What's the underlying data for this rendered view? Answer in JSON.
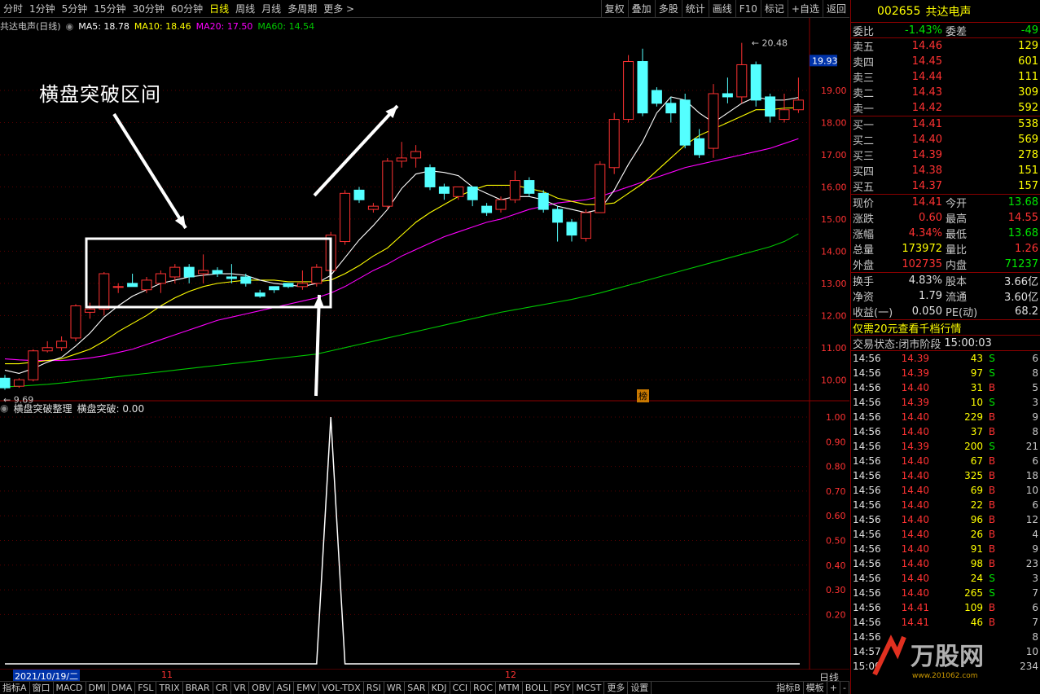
{
  "toolbar": {
    "items": [
      "分时",
      "1分钟",
      "5分钟",
      "15分钟",
      "30分钟",
      "60分钟",
      "日线",
      "周线",
      "月线",
      "多周期",
      "更多 >"
    ],
    "active": "日线",
    "right_items": [
      "复权",
      "叠加",
      "多股",
      "统计",
      "画线",
      "F10",
      "标记",
      "+自选",
      "返回"
    ]
  },
  "stock": {
    "code": "002655",
    "name": "共达电声"
  },
  "legend": {
    "title": "共达电声(日线)",
    "ma5": "MA5: 18.78",
    "ma10": "MA10: 18.46",
    "ma20": "MA20: 17.50",
    "ma60": "MA60: 14.54"
  },
  "colors": {
    "ma5": "#ffffff",
    "ma10": "#ffff00",
    "ma20": "#ff00ff",
    "ma60": "#00c800",
    "up": "#ff3232",
    "down": "#54ffff",
    "axis": "#8b0000"
  },
  "chart_data": [
    {
      "type": "candlestick",
      "title": "共达电声(日线)",
      "ylim": [
        9.5,
        20.8
      ],
      "yticks": [
        10.0,
        11.0,
        12.0,
        13.0,
        14.0,
        15.0,
        16.0,
        17.0,
        18.0,
        19.0
      ],
      "current_price_label": "19.93",
      "high_label": "20.48",
      "low_label": "9.69",
      "candles": [
        [
          10.05,
          9.75,
          10.15,
          9.69
        ],
        [
          9.8,
          10.0,
          10.05,
          9.75
        ],
        [
          10.0,
          10.9,
          10.95,
          9.95
        ],
        [
          10.9,
          11.0,
          11.2,
          10.85
        ],
        [
          11.0,
          11.2,
          11.35,
          10.9
        ],
        [
          11.3,
          12.3,
          12.35,
          11.2
        ],
        [
          12.1,
          12.2,
          12.4,
          11.9
        ],
        [
          12.2,
          13.3,
          13.35,
          12.0
        ],
        [
          12.9,
          12.9,
          13.0,
          12.7
        ],
        [
          13.0,
          12.9,
          13.3,
          12.9
        ],
        [
          12.8,
          13.1,
          13.2,
          12.7
        ],
        [
          13.0,
          13.3,
          13.4,
          12.7
        ],
        [
          13.2,
          13.5,
          13.6,
          13.0
        ],
        [
          13.5,
          13.2,
          13.6,
          13.0
        ],
        [
          13.3,
          13.4,
          13.9,
          13.0
        ],
        [
          13.4,
          13.3,
          13.5,
          13.2
        ],
        [
          13.2,
          13.15,
          13.6,
          13.0
        ],
        [
          13.2,
          13.0,
          13.3,
          12.9
        ],
        [
          12.7,
          12.6,
          12.8,
          12.55
        ],
        [
          12.9,
          12.8,
          12.9,
          12.7
        ],
        [
          13.0,
          12.9,
          13.0,
          12.85
        ],
        [
          12.9,
          13.0,
          13.4,
          12.8
        ],
        [
          13.0,
          13.5,
          13.6,
          12.9
        ],
        [
          13.4,
          14.5,
          14.6,
          13.3
        ],
        [
          14.3,
          15.8,
          15.9,
          14.2
        ],
        [
          15.9,
          15.6,
          16.0,
          15.5
        ],
        [
          15.3,
          15.4,
          15.5,
          15.2
        ],
        [
          15.4,
          16.8,
          16.9,
          15.3
        ],
        [
          16.8,
          16.9,
          17.4,
          16.6
        ],
        [
          16.9,
          17.1,
          17.3,
          16.6
        ],
        [
          16.6,
          16.0,
          16.7,
          15.9
        ],
        [
          16.0,
          15.8,
          16.1,
          15.6
        ],
        [
          15.7,
          16.0,
          16.0,
          15.6
        ],
        [
          16.0,
          15.6,
          16.0,
          15.4
        ],
        [
          15.4,
          15.2,
          15.5,
          15.1
        ],
        [
          15.3,
          15.6,
          15.7,
          15.2
        ],
        [
          15.6,
          16.2,
          16.5,
          15.5
        ],
        [
          16.2,
          15.8,
          16.3,
          15.7
        ],
        [
          15.8,
          15.3,
          15.9,
          15.2
        ],
        [
          15.3,
          14.9,
          15.4,
          14.3
        ],
        [
          14.9,
          14.5,
          15.0,
          14.3
        ],
        [
          14.4,
          15.2,
          15.3,
          14.3
        ],
        [
          15.2,
          16.7,
          16.8,
          15.2
        ],
        [
          16.6,
          18.1,
          18.3,
          16.4
        ],
        [
          18.1,
          19.9,
          20.1,
          18.0
        ],
        [
          19.9,
          18.3,
          20.3,
          18.2
        ],
        [
          19.0,
          18.6,
          19.1,
          18.5
        ],
        [
          18.6,
          18.3,
          18.8,
          18.0
        ],
        [
          18.7,
          17.3,
          18.9,
          17.2
        ],
        [
          17.5,
          17.0,
          17.8,
          16.9
        ],
        [
          17.2,
          18.9,
          19.2,
          16.9
        ],
        [
          18.9,
          18.8,
          19.4,
          18.6
        ],
        [
          18.8,
          19.8,
          20.48,
          18.6
        ],
        [
          19.8,
          18.7,
          19.9,
          18.5
        ],
        [
          18.8,
          18.2,
          18.9,
          18.0
        ],
        [
          18.1,
          18.4,
          18.9,
          18.0
        ],
        [
          18.4,
          18.7,
          19.4,
          18.3
        ]
      ],
      "ma5": [
        10.3,
        10.2,
        10.35,
        10.55,
        10.7,
        11.05,
        11.45,
        11.95,
        12.3,
        12.6,
        12.8,
        13.0,
        13.1,
        13.2,
        13.25,
        13.3,
        13.3,
        13.25,
        13.1,
        13.0,
        12.95,
        12.9,
        13.0,
        13.25,
        13.8,
        14.35,
        14.8,
        15.3,
        15.95,
        16.4,
        16.5,
        16.45,
        16.35,
        16.0,
        15.8,
        15.6,
        15.7,
        15.7,
        15.6,
        15.4,
        15.3,
        15.2,
        15.3,
        15.9,
        16.7,
        17.4,
        18.3,
        18.8,
        18.7,
        18.3,
        18.0,
        18.3,
        18.6,
        18.8,
        18.7,
        18.7,
        18.78
      ],
      "ma10": [
        10.5,
        10.5,
        10.55,
        10.6,
        10.65,
        10.8,
        10.95,
        11.2,
        11.5,
        11.75,
        12.0,
        12.3,
        12.55,
        12.75,
        12.9,
        13.0,
        13.05,
        13.1,
        13.1,
        13.1,
        13.05,
        13.05,
        13.05,
        13.1,
        13.3,
        13.55,
        13.85,
        14.1,
        14.5,
        14.9,
        15.2,
        15.45,
        15.7,
        15.9,
        16.05,
        16.05,
        16.05,
        15.95,
        15.85,
        15.65,
        15.55,
        15.45,
        15.45,
        15.5,
        15.8,
        16.1,
        16.5,
        16.9,
        17.3,
        17.6,
        17.8,
        18.0,
        18.2,
        18.4,
        18.4,
        18.45,
        18.46
      ],
      "ma20": [
        10.65,
        10.62,
        10.6,
        10.6,
        10.6,
        10.63,
        10.68,
        10.75,
        10.85,
        10.95,
        11.1,
        11.25,
        11.4,
        11.55,
        11.7,
        11.85,
        11.95,
        12.05,
        12.15,
        12.25,
        12.35,
        12.45,
        12.55,
        12.7,
        12.9,
        13.15,
        13.4,
        13.6,
        13.85,
        14.05,
        14.25,
        14.45,
        14.6,
        14.75,
        14.9,
        15.0,
        15.15,
        15.3,
        15.4,
        15.5,
        15.55,
        15.6,
        15.7,
        15.85,
        16.0,
        16.15,
        16.3,
        16.45,
        16.6,
        16.7,
        16.8,
        16.9,
        17.0,
        17.1,
        17.2,
        17.35,
        17.5
      ],
      "ma60": [
        9.78,
        9.8,
        9.83,
        9.86,
        9.9,
        9.95,
        10.0,
        10.05,
        10.1,
        10.15,
        10.2,
        10.25,
        10.3,
        10.35,
        10.4,
        10.45,
        10.5,
        10.55,
        10.6,
        10.65,
        10.7,
        10.75,
        10.8,
        10.9,
        11.0,
        11.1,
        11.2,
        11.3,
        11.4,
        11.5,
        11.6,
        11.7,
        11.8,
        11.9,
        12.0,
        12.1,
        12.18,
        12.26,
        12.34,
        12.42,
        12.5,
        12.6,
        12.7,
        12.82,
        12.94,
        13.06,
        13.18,
        13.3,
        13.42,
        13.54,
        13.66,
        13.78,
        13.9,
        14.02,
        14.14,
        14.3,
        14.54
      ]
    },
    {
      "type": "line",
      "title": "横盘突破整理",
      "series": [
        {
          "name": "横盘突破",
          "values": [
            0,
            0,
            0,
            0,
            0,
            0,
            0,
            0,
            0,
            0,
            0,
            0,
            0,
            0,
            0,
            0,
            0,
            0,
            0,
            0,
            0,
            0,
            0,
            1,
            0,
            0,
            0,
            0,
            0,
            0,
            0,
            0,
            0,
            0,
            0,
            0,
            0,
            0,
            0,
            0,
            0,
            0,
            0,
            0,
            0,
            0,
            0,
            0,
            0,
            0,
            0,
            0,
            0,
            0,
            0,
            0,
            0
          ]
        }
      ],
      "ylim": [
        0,
        1.05
      ],
      "yticks": [
        0.2,
        0.3,
        0.4,
        0.5,
        0.6,
        0.7,
        0.8,
        0.9,
        1.0
      ]
    }
  ],
  "annotation": "横盘突破区间",
  "sub_legend": {
    "name": "横盘突破整理",
    "value_label": "横盘突破: 0.00"
  },
  "date_axis": {
    "current": "2021/10/19/二",
    "marks": [
      "11",
      "12"
    ]
  },
  "badge": "榜",
  "right_label": "日线",
  "bottom_tabs": [
    "指标A",
    "窗口",
    "MACD",
    "DMI",
    "DMA",
    "FSL",
    "TRIX",
    "BRAR",
    "CR",
    "VR",
    "OBV",
    "ASI",
    "EMV",
    "VOL-TDX",
    "RSI",
    "WR",
    "SAR",
    "KDJ",
    "CCI",
    "ROC",
    "MTM",
    "BOLL",
    "PSY",
    "MCST",
    "更多",
    "设置"
  ],
  "bottom_right": [
    "指标B",
    "模板",
    "+",
    "-"
  ],
  "quote": {
    "weibi": {
      "label": "委比",
      "value": "-1.43%",
      "label2": "委差",
      "value2": "-49"
    },
    "asks": [
      {
        "label": "卖五",
        "price": "14.46",
        "vol": "129"
      },
      {
        "label": "卖四",
        "price": "14.45",
        "vol": "601"
      },
      {
        "label": "卖三",
        "price": "14.44",
        "vol": "111"
      },
      {
        "label": "卖二",
        "price": "14.43",
        "vol": "309"
      },
      {
        "label": "卖一",
        "price": "14.42",
        "vol": "592"
      }
    ],
    "bids": [
      {
        "label": "买一",
        "price": "14.41",
        "vol": "538"
      },
      {
        "label": "买二",
        "price": "14.40",
        "vol": "569"
      },
      {
        "label": "买三",
        "price": "14.39",
        "vol": "278"
      },
      {
        "label": "买四",
        "price": "14.38",
        "vol": "151"
      },
      {
        "label": "买五",
        "price": "14.37",
        "vol": "157"
      }
    ],
    "stats": [
      {
        "l1": "现价",
        "v1": "14.41",
        "c1": "red",
        "l2": "今开",
        "v2": "13.68",
        "c2": "green"
      },
      {
        "l1": "涨跌",
        "v1": "0.60",
        "c1": "red",
        "l2": "最高",
        "v2": "14.55",
        "c2": "red"
      },
      {
        "l1": "涨幅",
        "v1": "4.34%",
        "c1": "red",
        "l2": "最低",
        "v2": "13.68",
        "c2": "green"
      },
      {
        "l1": "总量",
        "v1": "173972",
        "c1": "yellow",
        "l2": "量比",
        "v2": "1.26",
        "c2": "red"
      },
      {
        "l1": "外盘",
        "v1": "102735",
        "c1": "red",
        "l2": "内盘",
        "v2": "71237",
        "c2": "green"
      }
    ],
    "fin": [
      {
        "l1": "换手",
        "v1": "4.83%",
        "l2": "股本",
        "v2": "3.66亿"
      },
      {
        "l1": "净资",
        "v1": "1.79",
        "l2": "流通",
        "v2": "3.60亿"
      },
      {
        "l1": "收益(一)",
        "v1": "0.050",
        "l2": "PE(动)",
        "v2": "68.2"
      }
    ],
    "promo": "仅需20元查看千档行情",
    "status": {
      "label": "交易状态:",
      "value": "闭市阶段",
      "time": "15:00:03"
    }
  },
  "ticks": [
    {
      "t": "14:56",
      "p": "14.39",
      "v": "43",
      "bs": "S",
      "n": "6"
    },
    {
      "t": "14:56",
      "p": "14.39",
      "v": "97",
      "bs": "S",
      "n": "8"
    },
    {
      "t": "14:56",
      "p": "14.40",
      "v": "31",
      "bs": "B",
      "n": "5"
    },
    {
      "t": "14:56",
      "p": "14.39",
      "v": "10",
      "bs": "S",
      "n": "3"
    },
    {
      "t": "14:56",
      "p": "14.40",
      "v": "229",
      "bs": "B",
      "n": "9"
    },
    {
      "t": "14:56",
      "p": "14.40",
      "v": "37",
      "bs": "B",
      "n": "8"
    },
    {
      "t": "14:56",
      "p": "14.39",
      "v": "200",
      "bs": "S",
      "n": "21"
    },
    {
      "t": "14:56",
      "p": "14.40",
      "v": "67",
      "bs": "B",
      "n": "6"
    },
    {
      "t": "14:56",
      "p": "14.40",
      "v": "325",
      "bs": "B",
      "n": "18"
    },
    {
      "t": "14:56",
      "p": "14.40",
      "v": "69",
      "bs": "B",
      "n": "10"
    },
    {
      "t": "14:56",
      "p": "14.40",
      "v": "22",
      "bs": "B",
      "n": "6"
    },
    {
      "t": "14:56",
      "p": "14.40",
      "v": "96",
      "bs": "B",
      "n": "12"
    },
    {
      "t": "14:56",
      "p": "14.40",
      "v": "26",
      "bs": "B",
      "n": "4"
    },
    {
      "t": "14:56",
      "p": "14.40",
      "v": "91",
      "bs": "B",
      "n": "9"
    },
    {
      "t": "14:56",
      "p": "14.40",
      "v": "98",
      "bs": "B",
      "n": "23"
    },
    {
      "t": "14:56",
      "p": "14.40",
      "v": "24",
      "bs": "S",
      "n": "3"
    },
    {
      "t": "14:56",
      "p": "14.40",
      "v": "265",
      "bs": "S",
      "n": "7"
    },
    {
      "t": "14:56",
      "p": "14.41",
      "v": "109",
      "bs": "B",
      "n": "6"
    },
    {
      "t": "14:56",
      "p": "14.41",
      "v": "46",
      "bs": "B",
      "n": "7"
    },
    {
      "t": "14:56",
      "p": "",
      "v": "",
      "bs": "",
      "n": "8"
    },
    {
      "t": "14:57",
      "p": "",
      "v": "",
      "bs": "",
      "n": "10"
    },
    {
      "t": "15:00",
      "p": "",
      "v": "",
      "bs": "",
      "n": "234"
    }
  ],
  "watermark": {
    "brand": "万股网",
    "url": "www.201062.com"
  }
}
